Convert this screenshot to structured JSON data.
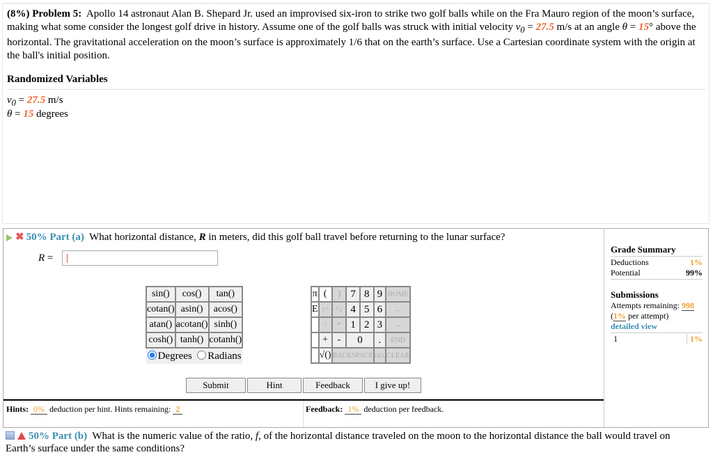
{
  "problem": {
    "weight": "(8%)",
    "title": "Problem 5:",
    "text_1": "Apollo 14 astronaut Alan B. Shepard Jr. used an improvised six-iron to strike two golf balls while on the Fra Mauro region of the moon’s surface, making what some consider the longest golf drive in history. Assume one of the golf balls was struck with initial velocity ",
    "v0_symbol": "v",
    "v0_sub": "0",
    "eq": " = ",
    "v0_value": "27.5",
    "text_2": " m/s at an angle ",
    "theta_symbol": "θ",
    "theta_value": "15",
    "text_3": "° above the horizontal. The gravitational acceleration on the moon’s surface is approximately 1/6 that on the earth’s surface. Use a Cartesian coordinate system with the origin at the ball's initial position."
  },
  "randomized": {
    "title": "Randomized Variables",
    "v0_value": "27.5",
    "v0_unit": " m/s",
    "theta_value": "15",
    "theta_unit": " degrees"
  },
  "part_a": {
    "weight": "50%",
    "label": "Part (a)",
    "question_1": "What horizontal distance, ",
    "var": "R",
    "question_2": " in meters, did this golf ball travel before returning to the lunar surface?",
    "input_label": "R",
    "input_value": ""
  },
  "calculator": {
    "functions": [
      [
        "sin()",
        "cos()",
        "tan()"
      ],
      [
        "cotan()",
        "asin()",
        "acos()"
      ],
      [
        "atan()",
        "acotan()",
        "sinh()"
      ],
      [
        "cosh()",
        "tanh()",
        "cotanh()"
      ]
    ],
    "degrees_label": "Degrees",
    "radians_label": "Radians",
    "angle_mode": "Degrees",
    "keys": {
      "pi": "π",
      "open_paren": "(",
      "close_paren": ")",
      "e": "E",
      "up": "↑^",
      "down": "^↓",
      "divide": "/",
      "multiply": "*",
      "plus": "+",
      "minus": "-",
      "zero": "0",
      "dot": ".",
      "sqrt": "√()",
      "backspace": "BACKSPACE",
      "del": "DEL",
      "home": "HOME",
      "left": "←",
      "right": "→",
      "end": "END",
      "clear": "CLEAR",
      "n7": "7",
      "n8": "8",
      "n9": "9",
      "n4": "4",
      "n5": "5",
      "n6": "6",
      "n1": "1",
      "n2": "2",
      "n3": "3"
    }
  },
  "buttons": {
    "submit": "Submit",
    "hint": "Hint",
    "feedback": "Feedback",
    "give_up": "I give up!"
  },
  "hints": {
    "label": "Hints:",
    "deduction": "0%",
    "text": " deduction per hint. Hints remaining: ",
    "remaining": "2"
  },
  "feedback": {
    "label": "Feedback:",
    "deduction": "1%",
    "text": " deduction per feedback."
  },
  "grade_summary": {
    "title": "Grade Summary",
    "deductions_label": "Deductions",
    "deductions_value": "1%",
    "potential_label": "Potential",
    "potential_value": "99%",
    "submissions_title": "Submissions",
    "attempts_label": "Attempts remaining: ",
    "attempts_value": "998",
    "per_attempt_open": "(",
    "per_attempt_value": "1%",
    "per_attempt_text": " per attempt)",
    "detailed_view": "detailed view",
    "history": [
      {
        "attempt": "1",
        "deduction": "1%"
      }
    ]
  },
  "part_b": {
    "weight": "50%",
    "label": "Part (b)",
    "question_1": "What is the numeric value of the ratio, ",
    "var": "f",
    "question_2": ", of the horizontal distance traveled on the moon to the horizontal distance the ball would travel on Earth’s surface under the same conditions?"
  }
}
